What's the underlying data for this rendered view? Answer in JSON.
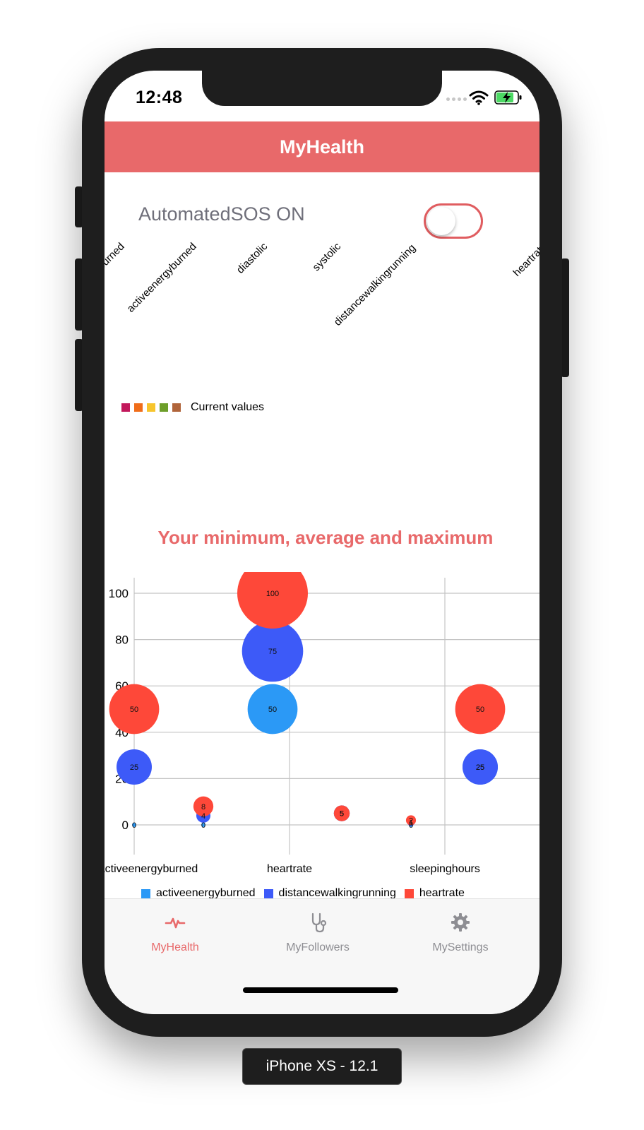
{
  "status_bar": {
    "time": "12:48"
  },
  "header": {
    "title": "MyHealth"
  },
  "sos": {
    "label": "AutomatedSOS ON",
    "toggle_on": false
  },
  "radar": {
    "axis_labels": [
      "activeenergyburned",
      "activeenergyburned",
      "diastolic",
      "systolic",
      "distancewalkingrunning",
      "heartrate"
    ],
    "legend": {
      "label": "Current values",
      "swatch_colors": [
        "#c2185b",
        "#f06d1a",
        "#f7c52d",
        "#6d9e2a",
        "#b0643a"
      ]
    }
  },
  "chart_title": "Your minimum, average and maximum",
  "chart_data": {
    "type": "bubble",
    "categories": [
      "activeenergyburned",
      "distancewalkingrunning",
      "heartrate",
      "systolic",
      "sleepinghours",
      "diastolic"
    ],
    "x_tick_labels": [
      "activeenergyburned",
      "heartrate",
      "sleepinghours"
    ],
    "y_ticks": [
      0,
      20,
      40,
      60,
      80,
      100
    ],
    "ylim": [
      0,
      110
    ],
    "grid": true,
    "legend_position": "bottom",
    "series": [
      {
        "name": "activeenergyburned",
        "color": "#2b99f6",
        "values": [
          0,
          0,
          50,
          5,
          0,
          25
        ]
      },
      {
        "name": "distancewalkingrunning",
        "color": "#3d5af8",
        "values": [
          25,
          4,
          75,
          5,
          1,
          25
        ]
      },
      {
        "name": "heartrate",
        "color": "#fe4839",
        "values": [
          50,
          8,
          100,
          5,
          2,
          50
        ]
      }
    ]
  },
  "tabs": [
    {
      "label": "MyHealth",
      "icon": "heartbeat-icon",
      "active": true
    },
    {
      "label": "MyFollowers",
      "icon": "stethoscope-icon",
      "active": false
    },
    {
      "label": "MySettings",
      "icon": "gear-icon",
      "active": false
    }
  ],
  "device_label": "iPhone XS - 12.1",
  "colors": {
    "accent": "#e8696a",
    "tab_inactive": "#8e8e93"
  }
}
